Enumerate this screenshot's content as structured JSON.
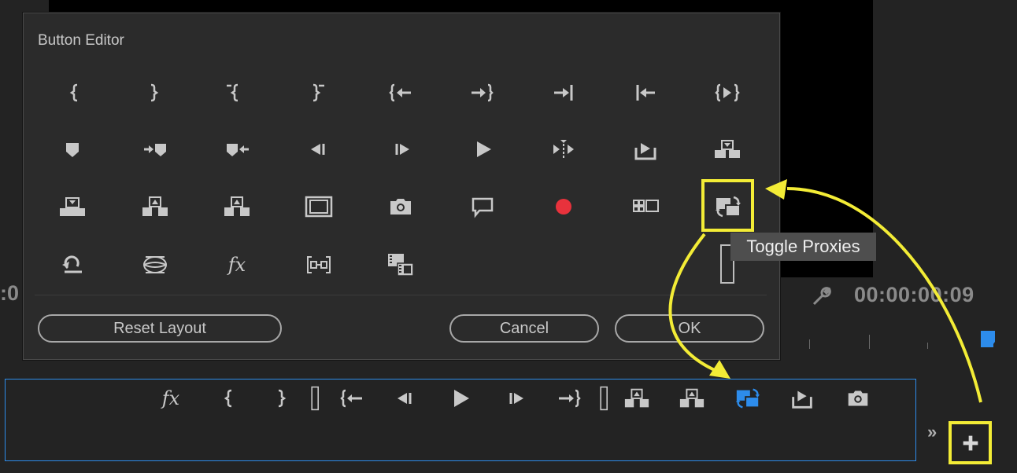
{
  "background": {
    "timecode_left": ":0",
    "timecode_right": "00:00:00:09"
  },
  "dialog": {
    "title": "Button Editor",
    "buttons": [
      {
        "icon": "mark-in-icon"
      },
      {
        "icon": "mark-out-icon"
      },
      {
        "icon": "mark-clip-in-icon"
      },
      {
        "icon": "mark-clip-out-icon"
      },
      {
        "icon": "go-to-in-icon"
      },
      {
        "icon": "go-to-out-icon"
      },
      {
        "icon": "go-to-next-edit-icon"
      },
      {
        "icon": "go-to-previous-edit-icon"
      },
      {
        "icon": "play-in-to-out-icon"
      },
      {
        "icon": "add-marker-icon"
      },
      {
        "icon": "go-to-next-marker-icon"
      },
      {
        "icon": "go-to-previous-marker-icon"
      },
      {
        "icon": "step-back-icon"
      },
      {
        "icon": "step-forward-icon"
      },
      {
        "icon": "play-icon"
      },
      {
        "icon": "shuttle-icon"
      },
      {
        "icon": "export-frame-icon"
      },
      {
        "icon": "insert-icon"
      },
      {
        "icon": "overwrite-icon"
      },
      {
        "icon": "lift-icon"
      },
      {
        "icon": "extract-icon"
      },
      {
        "icon": "safe-margins-icon"
      },
      {
        "icon": "camera-icon"
      },
      {
        "icon": "comment-icon"
      },
      {
        "icon": "record-icon"
      },
      {
        "icon": "multi-camera-icon"
      },
      {
        "icon": "toggle-proxies-icon"
      },
      {
        "icon": "loop-icon"
      },
      {
        "icon": "vr-video-icon"
      },
      {
        "icon": "fx-icon"
      },
      {
        "icon": "trim-icon"
      },
      {
        "icon": "compare-view-icon"
      }
    ],
    "reset_label": "Reset Layout",
    "cancel_label": "Cancel",
    "ok_label": "OK"
  },
  "tooltip": "Toggle Proxies",
  "toolbar": {
    "fx_label": "fx",
    "overflow_label": "»",
    "buttons": [
      "fx-icon",
      "mark-in-icon",
      "mark-out-icon",
      "spacer-icon",
      "go-to-in-icon",
      "step-back-icon",
      "play-icon",
      "step-forward-icon",
      "go-to-out-icon",
      "spacer-icon",
      "lift-icon",
      "extract-icon",
      "toggle-proxies-icon",
      "export-frame-icon",
      "camera-icon"
    ]
  },
  "colors": {
    "highlight": "#f3ec36",
    "accent": "#2d8ceb",
    "record": "#e8323c"
  }
}
